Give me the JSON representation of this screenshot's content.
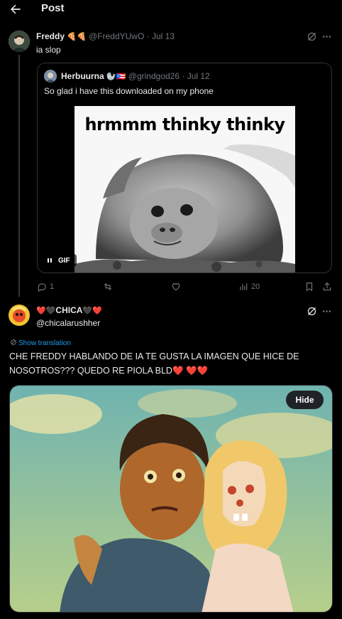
{
  "header": {
    "title": "Post"
  },
  "main_post": {
    "author_name": "Freddy",
    "author_emoji": "🍕🍕",
    "handle": "@FreddYUwO",
    "date": "Jul 13",
    "text": "ia slop"
  },
  "quoted_post": {
    "author_name": "Herbuurna",
    "author_emoji": "🦭🇵🇷",
    "handle": "@grindgod26",
    "date": "Jul 12",
    "text": "So glad i have this downloaded on my phone",
    "gif_caption": "hrmmm thinky thinky",
    "gif_badge": "GIF"
  },
  "actions": {
    "replies": "1",
    "views": "20"
  },
  "reply": {
    "author_name": "CHICA",
    "author_emoji_left": "❤️🖤",
    "author_emoji_right": "🖤❤️",
    "handle": "@chicalarushher",
    "translate_label": "Show translation",
    "text_line1": "CHE FREDDY HABLANDO DE IA TE GUSTA LA IMAGEN QUE HICE DE",
    "text_line2": "NOSOTROS??? QUEDO RE PIOLA BLD",
    "text_emoji": "❤️ ❤️❤️",
    "hide_label": "Hide"
  },
  "colors": {
    "accent": "#1d9bf0",
    "muted": "#71767b",
    "border": "#2f3336",
    "heart": "#e0245e"
  }
}
